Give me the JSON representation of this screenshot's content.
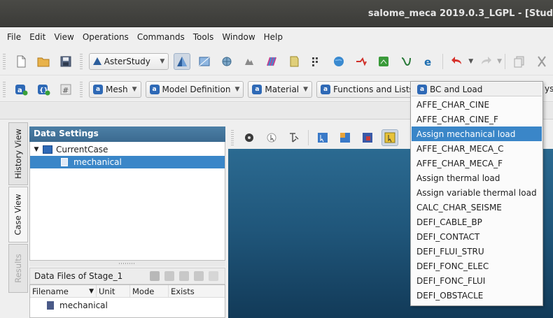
{
  "window": {
    "title": "salome_meca 2019.0.3_LGPL - [Stud"
  },
  "menubar": [
    "File",
    "Edit",
    "View",
    "Operations",
    "Commands",
    "Tools",
    "Window",
    "Help"
  ],
  "toolbar1": {
    "module_combo": "AsterStudy"
  },
  "toolbar2": {
    "mesh": "Mesh",
    "model_definition": "Model Definition",
    "material": "Material",
    "functions_lists": "Functions and Lists",
    "partial_label": "ysi"
  },
  "side_tabs": [
    "History View",
    "Case View",
    "Results"
  ],
  "data_settings": {
    "title": "Data Settings",
    "case_name": "CurrentCase",
    "stage_name": "mechanical"
  },
  "data_files": {
    "title": "Data Files of Stage_1",
    "columns": [
      "Filename",
      "Unit",
      "Mode",
      "Exists"
    ],
    "rows": [
      {
        "filename": "mechanical"
      }
    ]
  },
  "dropdown": {
    "header": "BC and Load",
    "items": [
      "AFFE_CHAR_CINE",
      "AFFE_CHAR_CINE_F",
      "Assign mechanical load",
      "AFFE_CHAR_MECA_C",
      "AFFE_CHAR_MECA_F",
      "Assign thermal load",
      "Assign variable thermal load",
      "CALC_CHAR_SEISME",
      "DEFI_CABLE_BP",
      "DEFI_CONTACT",
      "DEFI_FLUI_STRU",
      "DEFI_FONC_ELEC",
      "DEFI_FONC_FLUI",
      "DEFI_OBSTACLE"
    ],
    "highlighted": "Assign mechanical load"
  },
  "colors": {
    "accent": "#3a86c8",
    "header": "#3b6a90",
    "viewer_top": "#2b6a91",
    "viewer_bottom": "#123a58"
  }
}
